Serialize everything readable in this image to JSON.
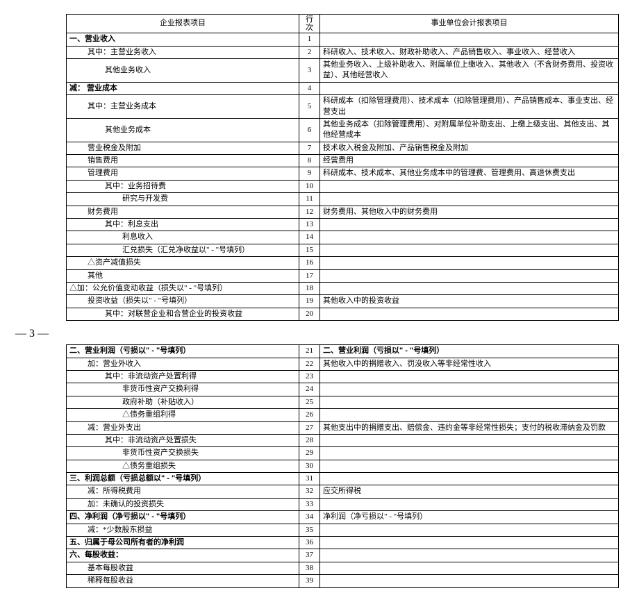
{
  "headers": {
    "col1": "企业报表项目",
    "col2": "行次",
    "col3": "事业单位会计报表项目"
  },
  "page_marker": "— 3 —",
  "rows_top": [
    {
      "l": "一、营业收入",
      "lcls": "bold",
      "n": "1",
      "r": ""
    },
    {
      "l": "其中：主营业务收入",
      "lcls": "ind1",
      "n": "2",
      "r": "科研收入、技术收入、财政补助收入、产品销售收入、事业收入、经营收入"
    },
    {
      "l": "其他业务收入",
      "lcls": "ind2",
      "n": "3",
      "r": "其他业务收入、上级补助收入、附属单位上缴收入、其他收入（不含财务费用、投资收益）、其他经营收入"
    },
    {
      "l": "减： 营业成本",
      "lcls": "bold",
      "n": "4",
      "r": ""
    },
    {
      "l": "其中：主营业务成本",
      "lcls": "ind1",
      "n": "5",
      "r": "科研成本（扣除管理费用）、技术成本（扣除管理费用）、产品销售成本、事业支出、经营支出"
    },
    {
      "l": "其他业务成本",
      "lcls": "ind2",
      "n": "6",
      "r": "其他业务成本（扣除管理费用）、对附属单位补助支出、上缴上级支出、其他支出、其他经营成本"
    },
    {
      "l": "营业税金及附加",
      "lcls": "ind1",
      "n": "7",
      "r": "技术收入税金及附加、产品销售税金及附加"
    },
    {
      "l": "销售费用",
      "lcls": "ind1",
      "n": "8",
      "r": "经营费用"
    },
    {
      "l": "管理费用",
      "lcls": "ind1",
      "n": "9",
      "r": "科研成本、技术成本、其他业务成本中的管理费、管理费用、高退休费支出"
    },
    {
      "l": "其中：业务招待费",
      "lcls": "ind2",
      "n": "10",
      "r": ""
    },
    {
      "l": "研究与开发费",
      "lcls": "ind3",
      "n": "11",
      "r": ""
    },
    {
      "l": "财务费用",
      "lcls": "ind1",
      "n": "12",
      "r": "财务费用、其他收入中的财务费用"
    },
    {
      "l": "其中：利息支出",
      "lcls": "ind2",
      "n": "13",
      "r": ""
    },
    {
      "l": "利息收入",
      "lcls": "ind3",
      "n": "14",
      "r": ""
    },
    {
      "l": "汇兑损失（汇兑净收益以\" - \"号填列）",
      "lcls": "ind3",
      "n": "15",
      "r": ""
    },
    {
      "l": "△资产减值损失",
      "lcls": "ind1",
      "n": "16",
      "r": ""
    },
    {
      "l": "其他",
      "lcls": "ind1",
      "n": "17",
      "r": ""
    },
    {
      "l": "△加：公允价值变动收益（损失以\" - \"号填列）",
      "lcls": "",
      "n": "18",
      "r": ""
    },
    {
      "l": "投资收益（损失以\" - \"号填列）",
      "lcls": "ind1",
      "n": "19",
      "r": "其他收入中的投资收益"
    },
    {
      "l": "其中：对联营企业和合营企业的投资收益",
      "lcls": "ind2",
      "n": "20",
      "r": ""
    }
  ],
  "rows_bottom": [
    {
      "l": "二、营业利润（亏损以\" - \"号填列）",
      "lcls": "bold",
      "n": "21",
      "r": "二、营业利润（亏损以\" - \"号填列）",
      "rcls": "bold"
    },
    {
      "l": "加：营业外收入",
      "lcls": "ind1",
      "n": "22",
      "r": "其他收入中的捐赠收入、罚没收入等非经常性收入"
    },
    {
      "l": "其中：非流动资产处置利得",
      "lcls": "ind2",
      "n": "23",
      "r": ""
    },
    {
      "l": "非货币性资产交换利得",
      "lcls": "ind3",
      "n": "24",
      "r": ""
    },
    {
      "l": "政府补助（补贴收入）",
      "lcls": "ind3",
      "n": "25",
      "r": ""
    },
    {
      "l": "△债务重组利得",
      "lcls": "ind3",
      "n": "26",
      "r": ""
    },
    {
      "l": "减：营业外支出",
      "lcls": "ind1",
      "n": "27",
      "r": "其他支出中的捐赠支出、赔偿金、违约金等非经常性损失；支付的税收滞纳金及罚款"
    },
    {
      "l": "其中：非流动资产处置损失",
      "lcls": "ind2",
      "n": "28",
      "r": ""
    },
    {
      "l": "非货币性资产交换损失",
      "lcls": "ind3",
      "n": "29",
      "r": ""
    },
    {
      "l": "△债务重组损失",
      "lcls": "ind3",
      "n": "30",
      "r": ""
    },
    {
      "l": "三、利润总额（亏损总额以\" - \"号填列）",
      "lcls": "bold",
      "n": "31",
      "r": ""
    },
    {
      "l": "减：所得税费用",
      "lcls": "ind1",
      "n": "32",
      "r": "应交所得税"
    },
    {
      "l": "加：未确认的投资损失",
      "lcls": "ind1",
      "n": "33",
      "r": ""
    },
    {
      "l": "四、净利润（净亏损以\" - \"号填列）",
      "lcls": "bold",
      "n": "34",
      "r": "净利润（净亏损以\" - \"号填列）"
    },
    {
      "l": "减：*少数股东损益",
      "lcls": "ind1",
      "n": "35",
      "r": ""
    },
    {
      "l": "五、归属于母公司所有者的净利润",
      "lcls": "bold",
      "n": "36",
      "r": ""
    },
    {
      "l": "六、每股收益：",
      "lcls": "bold",
      "n": "37",
      "r": ""
    },
    {
      "l": "基本每股收益",
      "lcls": "ind1",
      "n": "38",
      "r": ""
    },
    {
      "l": "稀释每股收益",
      "lcls": "ind1",
      "n": "39",
      "r": ""
    }
  ]
}
